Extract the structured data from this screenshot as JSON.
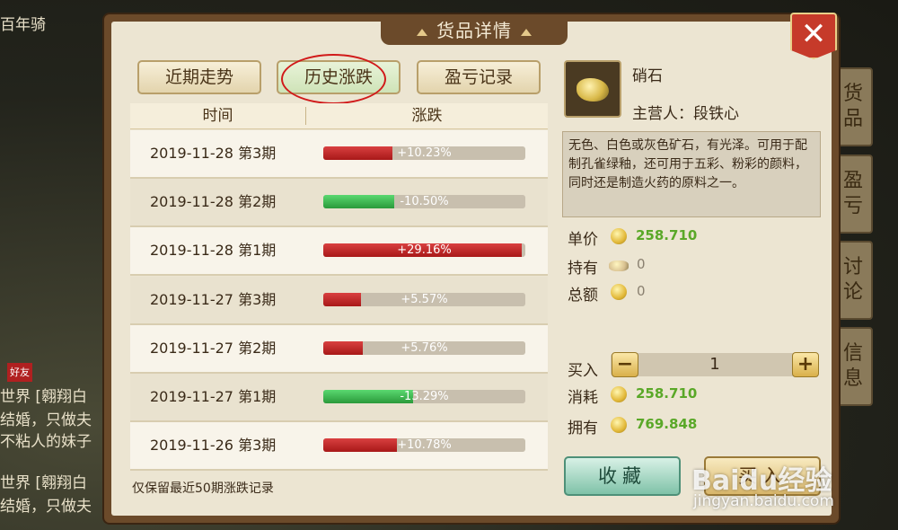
{
  "dialog": {
    "title": "货品详情",
    "close_label": "✕"
  },
  "tabs": [
    {
      "label": "近期走势",
      "active": false
    },
    {
      "label": "历史涨跌",
      "active": true
    },
    {
      "label": "盈亏记录",
      "active": false
    }
  ],
  "table": {
    "headers": [
      "时间",
      "涨跌"
    ],
    "rows": [
      {
        "date": "2019-11-28 第3期",
        "change": "+10.23%",
        "pct": 10.23,
        "dir": "up"
      },
      {
        "date": "2019-11-28 第2期",
        "change": "-10.50%",
        "pct": 10.5,
        "dir": "down"
      },
      {
        "date": "2019-11-28 第1期",
        "change": "+29.16%",
        "pct": 29.16,
        "dir": "up"
      },
      {
        "date": "2019-11-27 第3期",
        "change": "+5.57%",
        "pct": 5.57,
        "dir": "up"
      },
      {
        "date": "2019-11-27 第2期",
        "change": "+5.76%",
        "pct": 5.76,
        "dir": "up"
      },
      {
        "date": "2019-11-27 第1期",
        "change": "-13.29%",
        "pct": 13.29,
        "dir": "down"
      },
      {
        "date": "2019-11-26 第3期",
        "change": "+10.78%",
        "pct": 10.78,
        "dir": "up"
      }
    ],
    "footnote": "仅保留最近50期涨跌记录"
  },
  "item": {
    "name": "硝石",
    "owner": "主营人：段铁心",
    "description": "无色、白色或灰色矿石，有光泽。可用于配制孔雀绿釉，还可用于五彩、粉彩的颜料，同时还是制造火药的原料之一。",
    "icon": "saltpeter-rock-icon"
  },
  "stats": {
    "unit_price_label": "单价",
    "unit_price": "258.710",
    "holding_label": "持有",
    "holding": "0",
    "total_label": "总额",
    "total": "0"
  },
  "trade": {
    "buy_label": "买入",
    "quantity": "1",
    "minus": "−",
    "plus": "+",
    "cost_label": "消耗",
    "cost": "258.710",
    "own_label": "拥有",
    "own": "769.848"
  },
  "buttons": {
    "favorite": "收藏",
    "buy": "买入"
  },
  "background": {
    "top_left": "百年骑",
    "chat_lines": [
      "世界 [翱翔白",
      "结婚，只做夫",
      "不粘人的妹子",
      "世界 [翱翔白",
      "结婚，只做夫"
    ],
    "friend_label": "好友",
    "right_tabs": [
      "货品",
      "盈亏",
      "讨论",
      "信息"
    ]
  },
  "watermark": {
    "text": "Baidu经验",
    "url": "jingyan.baidu.com"
  },
  "colors": {
    "up": "#b82020",
    "down": "#2a9a3a",
    "accent_green": "#5aa828",
    "close": "#c63a2a"
  }
}
